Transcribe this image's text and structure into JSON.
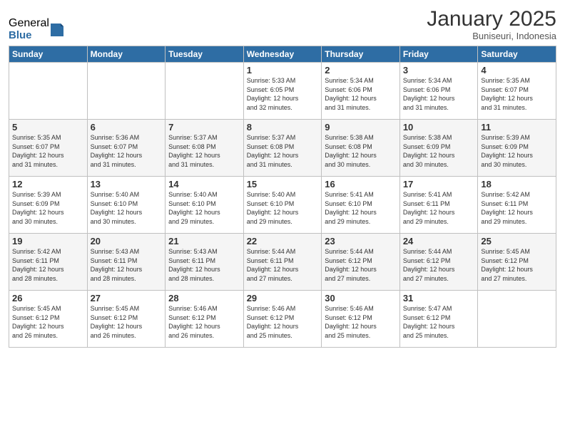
{
  "logo": {
    "general": "General",
    "blue": "Blue"
  },
  "header": {
    "month": "January 2025",
    "location": "Buniseuri, Indonesia"
  },
  "weekdays": [
    "Sunday",
    "Monday",
    "Tuesday",
    "Wednesday",
    "Thursday",
    "Friday",
    "Saturday"
  ],
  "weeks": [
    [
      {
        "day": "",
        "info": ""
      },
      {
        "day": "",
        "info": ""
      },
      {
        "day": "",
        "info": ""
      },
      {
        "day": "1",
        "info": "Sunrise: 5:33 AM\nSunset: 6:05 PM\nDaylight: 12 hours\nand 32 minutes."
      },
      {
        "day": "2",
        "info": "Sunrise: 5:34 AM\nSunset: 6:06 PM\nDaylight: 12 hours\nand 31 minutes."
      },
      {
        "day": "3",
        "info": "Sunrise: 5:34 AM\nSunset: 6:06 PM\nDaylight: 12 hours\nand 31 minutes."
      },
      {
        "day": "4",
        "info": "Sunrise: 5:35 AM\nSunset: 6:07 PM\nDaylight: 12 hours\nand 31 minutes."
      }
    ],
    [
      {
        "day": "5",
        "info": "Sunrise: 5:35 AM\nSunset: 6:07 PM\nDaylight: 12 hours\nand 31 minutes."
      },
      {
        "day": "6",
        "info": "Sunrise: 5:36 AM\nSunset: 6:07 PM\nDaylight: 12 hours\nand 31 minutes."
      },
      {
        "day": "7",
        "info": "Sunrise: 5:37 AM\nSunset: 6:08 PM\nDaylight: 12 hours\nand 31 minutes."
      },
      {
        "day": "8",
        "info": "Sunrise: 5:37 AM\nSunset: 6:08 PM\nDaylight: 12 hours\nand 31 minutes."
      },
      {
        "day": "9",
        "info": "Sunrise: 5:38 AM\nSunset: 6:08 PM\nDaylight: 12 hours\nand 30 minutes."
      },
      {
        "day": "10",
        "info": "Sunrise: 5:38 AM\nSunset: 6:09 PM\nDaylight: 12 hours\nand 30 minutes."
      },
      {
        "day": "11",
        "info": "Sunrise: 5:39 AM\nSunset: 6:09 PM\nDaylight: 12 hours\nand 30 minutes."
      }
    ],
    [
      {
        "day": "12",
        "info": "Sunrise: 5:39 AM\nSunset: 6:09 PM\nDaylight: 12 hours\nand 30 minutes."
      },
      {
        "day": "13",
        "info": "Sunrise: 5:40 AM\nSunset: 6:10 PM\nDaylight: 12 hours\nand 30 minutes."
      },
      {
        "day": "14",
        "info": "Sunrise: 5:40 AM\nSunset: 6:10 PM\nDaylight: 12 hours\nand 29 minutes."
      },
      {
        "day": "15",
        "info": "Sunrise: 5:40 AM\nSunset: 6:10 PM\nDaylight: 12 hours\nand 29 minutes."
      },
      {
        "day": "16",
        "info": "Sunrise: 5:41 AM\nSunset: 6:10 PM\nDaylight: 12 hours\nand 29 minutes."
      },
      {
        "day": "17",
        "info": "Sunrise: 5:41 AM\nSunset: 6:11 PM\nDaylight: 12 hours\nand 29 minutes."
      },
      {
        "day": "18",
        "info": "Sunrise: 5:42 AM\nSunset: 6:11 PM\nDaylight: 12 hours\nand 29 minutes."
      }
    ],
    [
      {
        "day": "19",
        "info": "Sunrise: 5:42 AM\nSunset: 6:11 PM\nDaylight: 12 hours\nand 28 minutes."
      },
      {
        "day": "20",
        "info": "Sunrise: 5:43 AM\nSunset: 6:11 PM\nDaylight: 12 hours\nand 28 minutes."
      },
      {
        "day": "21",
        "info": "Sunrise: 5:43 AM\nSunset: 6:11 PM\nDaylight: 12 hours\nand 28 minutes."
      },
      {
        "day": "22",
        "info": "Sunrise: 5:44 AM\nSunset: 6:11 PM\nDaylight: 12 hours\nand 27 minutes."
      },
      {
        "day": "23",
        "info": "Sunrise: 5:44 AM\nSunset: 6:12 PM\nDaylight: 12 hours\nand 27 minutes."
      },
      {
        "day": "24",
        "info": "Sunrise: 5:44 AM\nSunset: 6:12 PM\nDaylight: 12 hours\nand 27 minutes."
      },
      {
        "day": "25",
        "info": "Sunrise: 5:45 AM\nSunset: 6:12 PM\nDaylight: 12 hours\nand 27 minutes."
      }
    ],
    [
      {
        "day": "26",
        "info": "Sunrise: 5:45 AM\nSunset: 6:12 PM\nDaylight: 12 hours\nand 26 minutes."
      },
      {
        "day": "27",
        "info": "Sunrise: 5:45 AM\nSunset: 6:12 PM\nDaylight: 12 hours\nand 26 minutes."
      },
      {
        "day": "28",
        "info": "Sunrise: 5:46 AM\nSunset: 6:12 PM\nDaylight: 12 hours\nand 26 minutes."
      },
      {
        "day": "29",
        "info": "Sunrise: 5:46 AM\nSunset: 6:12 PM\nDaylight: 12 hours\nand 25 minutes."
      },
      {
        "day": "30",
        "info": "Sunrise: 5:46 AM\nSunset: 6:12 PM\nDaylight: 12 hours\nand 25 minutes."
      },
      {
        "day": "31",
        "info": "Sunrise: 5:47 AM\nSunset: 6:12 PM\nDaylight: 12 hours\nand 25 minutes."
      },
      {
        "day": "",
        "info": ""
      }
    ]
  ]
}
